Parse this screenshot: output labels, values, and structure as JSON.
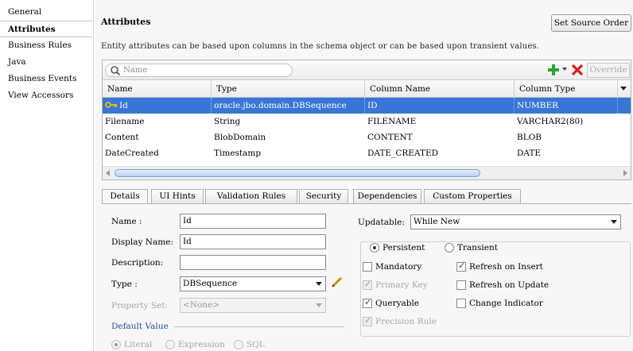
{
  "nav": {
    "items": [
      {
        "label": "General"
      },
      {
        "label": "Attributes"
      },
      {
        "label": "Business Rules"
      },
      {
        "label": "Java"
      },
      {
        "label": "Business Events"
      },
      {
        "label": "View Accessors"
      }
    ]
  },
  "header": {
    "title": "Attributes",
    "set_source_order_label": "Set Source Order",
    "description": "Entity attributes can be based upon columns in the schema object or can be based upon transient values."
  },
  "toolbar": {
    "search_placeholder": "Name",
    "override_label": "Override",
    "add_icon": "green-plus-icon",
    "delete_icon": "red-x-icon"
  },
  "table": {
    "columns": [
      "Name",
      "Type",
      "Column Name",
      "Column Type"
    ],
    "rows": [
      {
        "name": "Id",
        "type": "oracle.jbo.domain.DBSequence",
        "column_name": "ID",
        "column_type": "NUMBER"
      },
      {
        "name": "Filename",
        "type": "String",
        "column_name": "FILENAME",
        "column_type": "VARCHAR2(80)"
      },
      {
        "name": "Content",
        "type": "BlobDomain",
        "column_name": "CONTENT",
        "column_type": "BLOB"
      },
      {
        "name": "DateCreated",
        "type": "Timestamp",
        "column_name": "DATE_CREATED",
        "column_type": "DATE"
      }
    ],
    "selected_row": 0
  },
  "tabs": [
    "Details",
    "UI Hints",
    "Validation Rules",
    "Security",
    "Dependencies",
    "Custom Properties"
  ],
  "details": {
    "name_label": "Name :",
    "name_value": "Id",
    "display_name_label": "Display Name:",
    "display_name_value": "Id",
    "description_label": "Description:",
    "description_value": "",
    "type_label": "Type :",
    "type_value": "DBSequence",
    "property_set_label": "Property Set:",
    "property_set_value": "<None>",
    "default_value_label": "Default Value",
    "default_options": [
      "Literal",
      "Expression",
      "SQL"
    ],
    "updatable_label": "Updatable:",
    "updatable_value": "While New",
    "persistent_label": "Persistent",
    "transient_label": "Transient",
    "checks": {
      "mandatory": "Mandatory",
      "primary_key": "Primary Key",
      "queryable": "Queryable",
      "precision_rule": "Precision Rule",
      "refresh_on_insert": "Refresh on Insert",
      "refresh_on_update": "Refresh on Update",
      "change_indicator": "Change Indicator"
    }
  },
  "colors": {
    "selection": "#3875d7",
    "section_label": "#2a4f9a",
    "checkmark": "#1e3f86"
  }
}
